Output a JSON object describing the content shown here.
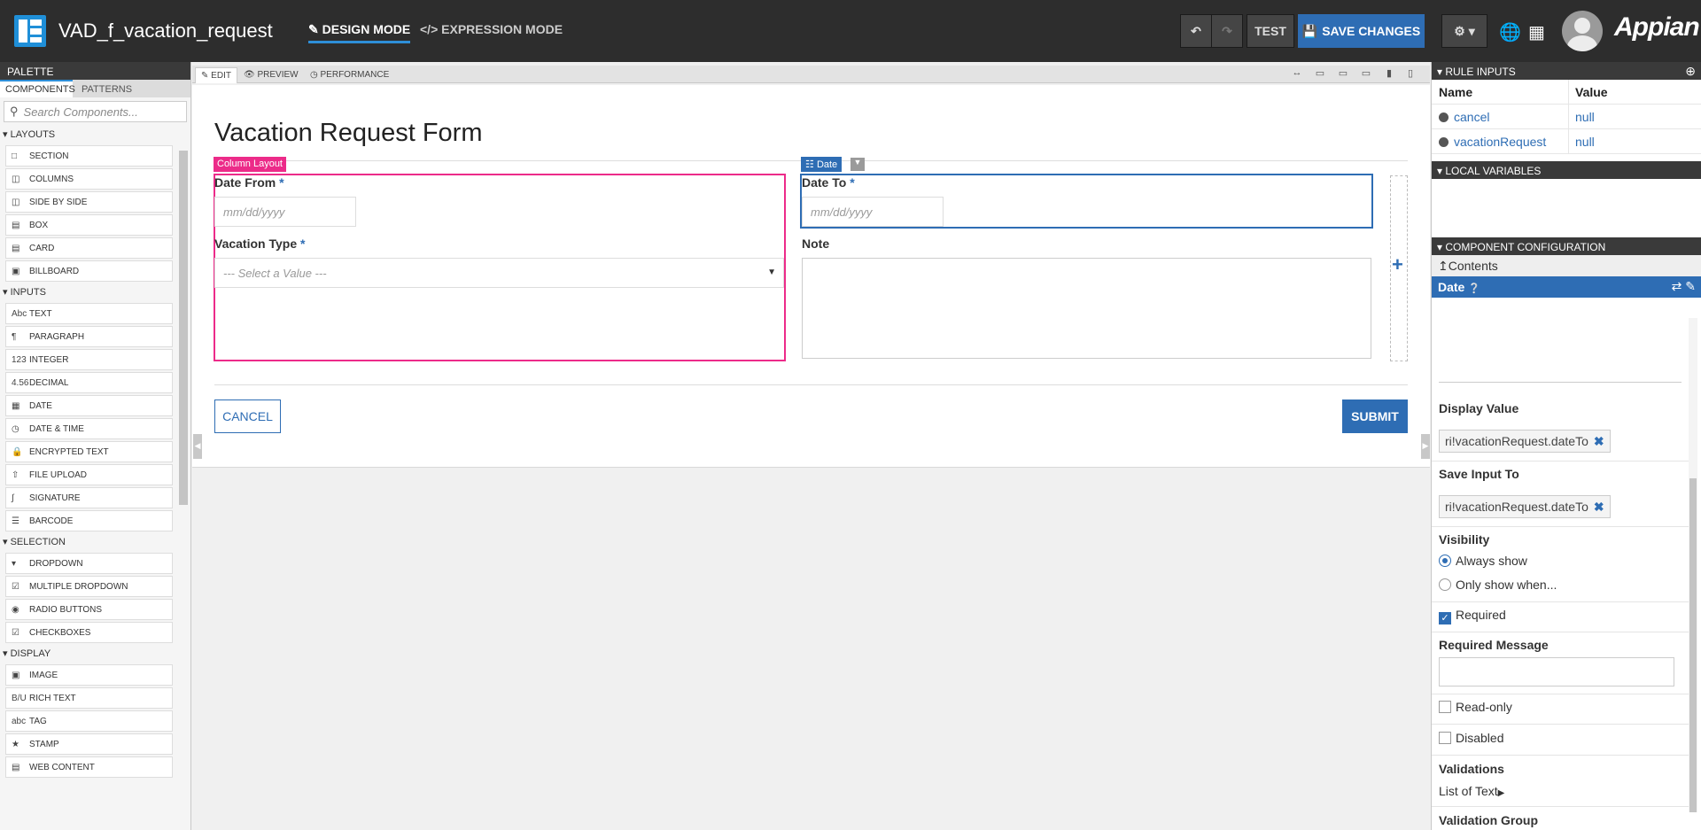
{
  "topbar": {
    "title": "VAD_f_vacation_request",
    "design_mode": "DESIGN MODE",
    "expression_mode": "EXPRESSION MODE",
    "test_label": "TEST",
    "save_label": "SAVE CHANGES",
    "brand": "Appian",
    "accent": "#2e6db4"
  },
  "palette": {
    "title": "PALETTE",
    "tabs": [
      "COMPONENTS",
      "PATTERNS"
    ],
    "search_placeholder": "Search Components...",
    "sections": [
      {
        "label": "LAYOUTS",
        "items": [
          {
            "icon": "section-icon",
            "label": "SECTION"
          },
          {
            "icon": "columns-icon",
            "label": "COLUMNS"
          },
          {
            "icon": "side-by-side-icon",
            "label": "SIDE BY SIDE"
          },
          {
            "icon": "box-icon",
            "label": "BOX"
          },
          {
            "icon": "card-icon",
            "label": "CARD"
          },
          {
            "icon": "billboard-icon",
            "label": "BILLBOARD"
          }
        ]
      },
      {
        "label": "INPUTS",
        "items": [
          {
            "icon": "text-icon",
            "label": "TEXT"
          },
          {
            "icon": "paragraph-icon",
            "label": "PARAGRAPH"
          },
          {
            "icon": "integer-icon",
            "label": "INTEGER"
          },
          {
            "icon": "decimal-icon",
            "label": "DECIMAL"
          },
          {
            "icon": "calendar-icon",
            "label": "DATE"
          },
          {
            "icon": "calendar-clock-icon",
            "label": "DATE & TIME"
          },
          {
            "icon": "lock-icon",
            "label": "ENCRYPTED TEXT"
          },
          {
            "icon": "upload-icon",
            "label": "FILE UPLOAD"
          },
          {
            "icon": "signature-icon",
            "label": "SIGNATURE"
          },
          {
            "icon": "barcode-icon",
            "label": "BARCODE"
          }
        ]
      },
      {
        "label": "SELECTION",
        "items": [
          {
            "icon": "dropdown-icon",
            "label": "DROPDOWN"
          },
          {
            "icon": "multi-dropdown-icon",
            "label": "MULTIPLE DROPDOWN"
          },
          {
            "icon": "radio-icon",
            "label": "RADIO BUTTONS"
          },
          {
            "icon": "checkbox-icon",
            "label": "CHECKBOXES"
          }
        ]
      },
      {
        "label": "DISPLAY",
        "items": [
          {
            "icon": "image-icon",
            "label": "IMAGE"
          },
          {
            "icon": "rich-text-icon",
            "label": "RICH TEXT"
          },
          {
            "icon": "tag-icon",
            "label": "TAG"
          },
          {
            "icon": "stamp-icon",
            "label": "STAMP"
          },
          {
            "icon": "web-content-icon",
            "label": "WEB CONTENT"
          }
        ]
      }
    ]
  },
  "canvas": {
    "tabs": [
      "EDIT",
      "PREVIEW",
      "PERFORMANCE"
    ],
    "form_title": "Vacation Request Form",
    "column_tag": "Column Layout",
    "date_tag": "Date",
    "date_from_label": "Date From",
    "date_to_label": "Date To",
    "required_mark": "*",
    "date_placeholder": "mm/dd/yyyy",
    "vacation_type_label": "Vacation Type",
    "select_placeholder": "--- Select a Value ---",
    "note_label": "Note",
    "cancel_label": "CANCEL",
    "submit_label": "SUBMIT"
  },
  "rightpanel": {
    "rule_inputs_title": "RULE INPUTS",
    "col_name": "Name",
    "col_value": "Value",
    "rule_inputs": [
      {
        "name": "cancel",
        "value": "null"
      },
      {
        "name": "vacationRequest",
        "value": "null"
      }
    ],
    "local_vars_title": "LOCAL VARIABLES",
    "component_config_title": "COMPONENT CONFIGURATION",
    "contents_label": "Contents",
    "selected_component": "Date",
    "display_value_label": "Display Value",
    "display_value": "ri!vacationRequest.dateTo",
    "save_input_label": "Save Input To",
    "save_input_value": "ri!vacationRequest.dateTo",
    "visibility_label": "Visibility",
    "visibility_always": "Always show",
    "visibility_when": "Only show when...",
    "visibility_selected": "Always show",
    "required_label": "Required",
    "required_checked": true,
    "required_message_label": "Required Message",
    "readonly_label": "Read-only",
    "readonly_checked": false,
    "disabled_label": "Disabled",
    "disabled_checked": false,
    "validations_label": "Validations",
    "validations_link": "List of Text",
    "validation_group_label": "Validation Group"
  }
}
